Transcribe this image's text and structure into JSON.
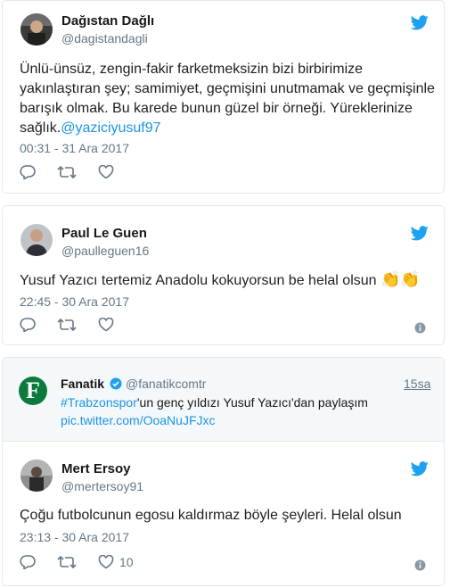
{
  "tweets": [
    {
      "name": "Dağıstan Dağlı",
      "handle": "@dagistandagli",
      "text": "Ünlü-ünsüz, zengin-fakir farketmeksizin bizi birbirimize yakınlaştıran şey; samimiyet, geçmişini unutmamak ve geçmişinle barışık olmak. Bu karede bunun güzel bir örneği. Yüreklerinize sağlık.",
      "mention": "@yaziciyusuf97",
      "time": "00:31 - 31 Ara 2017",
      "avatar": "avatar-photo"
    },
    {
      "name": "Paul Le Guen",
      "handle": "@paulleguen16",
      "text": "Yusuf Yazıcı tertemiz Anadolu kokuyorsun be helal olsun",
      "emoji": "👏👏",
      "time": "22:45 - 30 Ara 2017",
      "avatar": "avatar-photo"
    },
    {
      "quoted": {
        "name": "Fanatik",
        "handle": "@fanatikcomtr",
        "time": "15sa",
        "hashtag": "#Trabzonspor",
        "text": "'un genç yıldızı Yusuf Yazıcı'dan paylaşım",
        "link": "pic.twitter.com/OoaNuJFJxc",
        "avatar_letter": "F",
        "avatar_color": "#0b7a3b"
      },
      "name": "Mert Ersoy",
      "handle": "@mertersoy91",
      "text": "Çoğu futbolcunun egosu kaldırmaz böyle şeyleri. Helal olsun",
      "time": "23:13 - 30 Ara 2017",
      "likes": "10",
      "avatar": "avatar-photo"
    }
  ],
  "colors": {
    "link": "#1b95e0",
    "twitter_blue": "#1da1f2",
    "muted": "#657786",
    "border": "#e1e8ed"
  },
  "icons": [
    "twitter-bird-icon",
    "reply-icon",
    "retweet-icon",
    "heart-icon",
    "info-icon",
    "verified-icon"
  ]
}
